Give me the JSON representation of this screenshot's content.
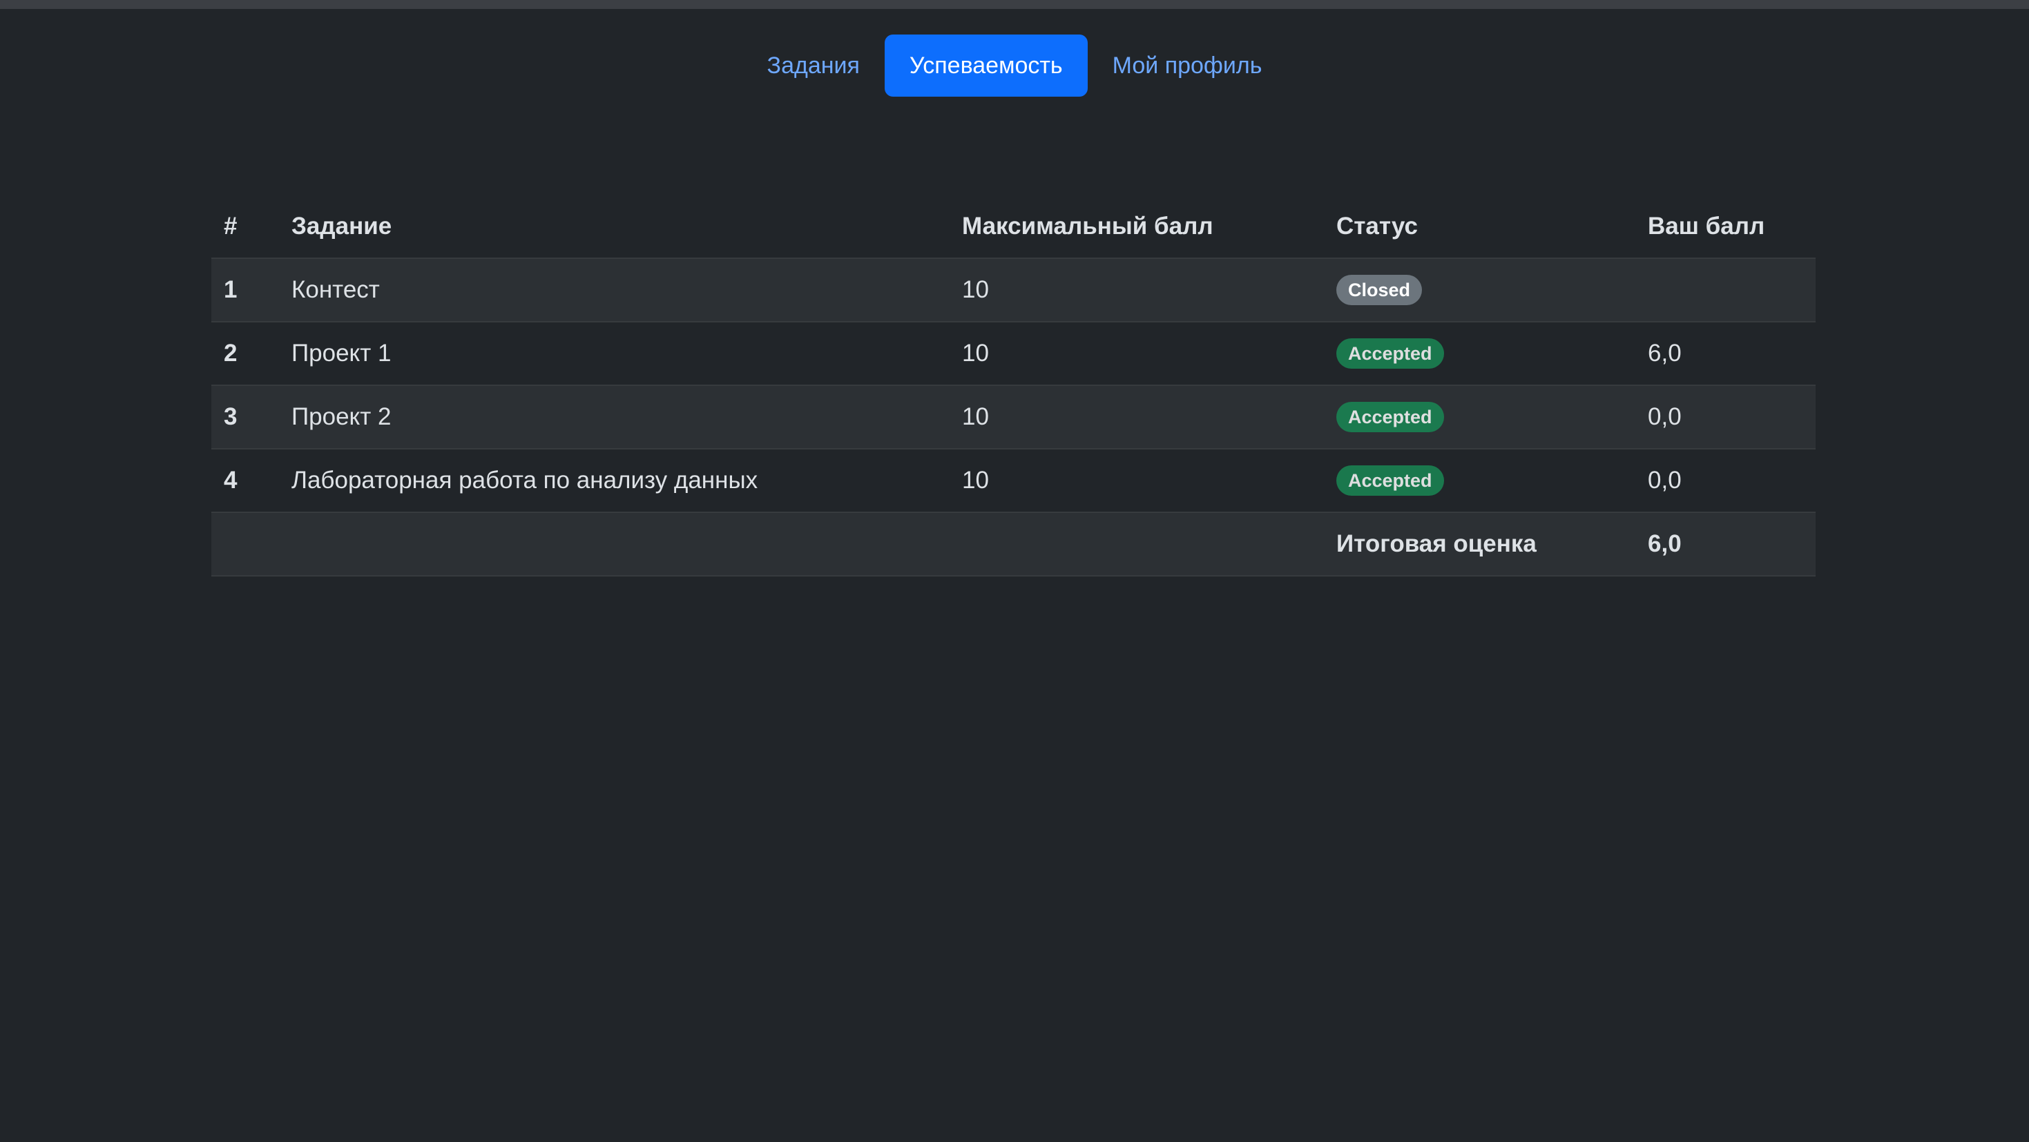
{
  "nav": {
    "items": [
      {
        "label": "Задания",
        "active": false
      },
      {
        "label": "Успеваемость",
        "active": true
      },
      {
        "label": "Мой профиль",
        "active": false
      }
    ]
  },
  "table": {
    "headers": {
      "num": "#",
      "task": "Задание",
      "max": "Максимальный балл",
      "status": "Статус",
      "score": "Ваш балл"
    },
    "rows": [
      {
        "num": "1",
        "task": "Контест",
        "max": "10",
        "status": "Closed",
        "status_type": "closed",
        "score": ""
      },
      {
        "num": "2",
        "task": "Проект 1",
        "max": "10",
        "status": "Accepted",
        "status_type": "accepted",
        "score": "6,0"
      },
      {
        "num": "3",
        "task": "Проект 2",
        "max": "10",
        "status": "Accepted",
        "status_type": "accepted",
        "score": "0,0"
      },
      {
        "num": "4",
        "task": "Лабораторная работа по анализу данных",
        "max": "10",
        "status": "Accepted",
        "status_type": "accepted",
        "score": "0,0"
      }
    ],
    "total": {
      "label": "Итоговая оценка",
      "value": "6,0"
    }
  },
  "colors": {
    "background": "#212529",
    "accent": "#0d6efd",
    "link": "#6ea8fe",
    "badge_closed": "#6c757d",
    "badge_accepted": "#198754"
  }
}
